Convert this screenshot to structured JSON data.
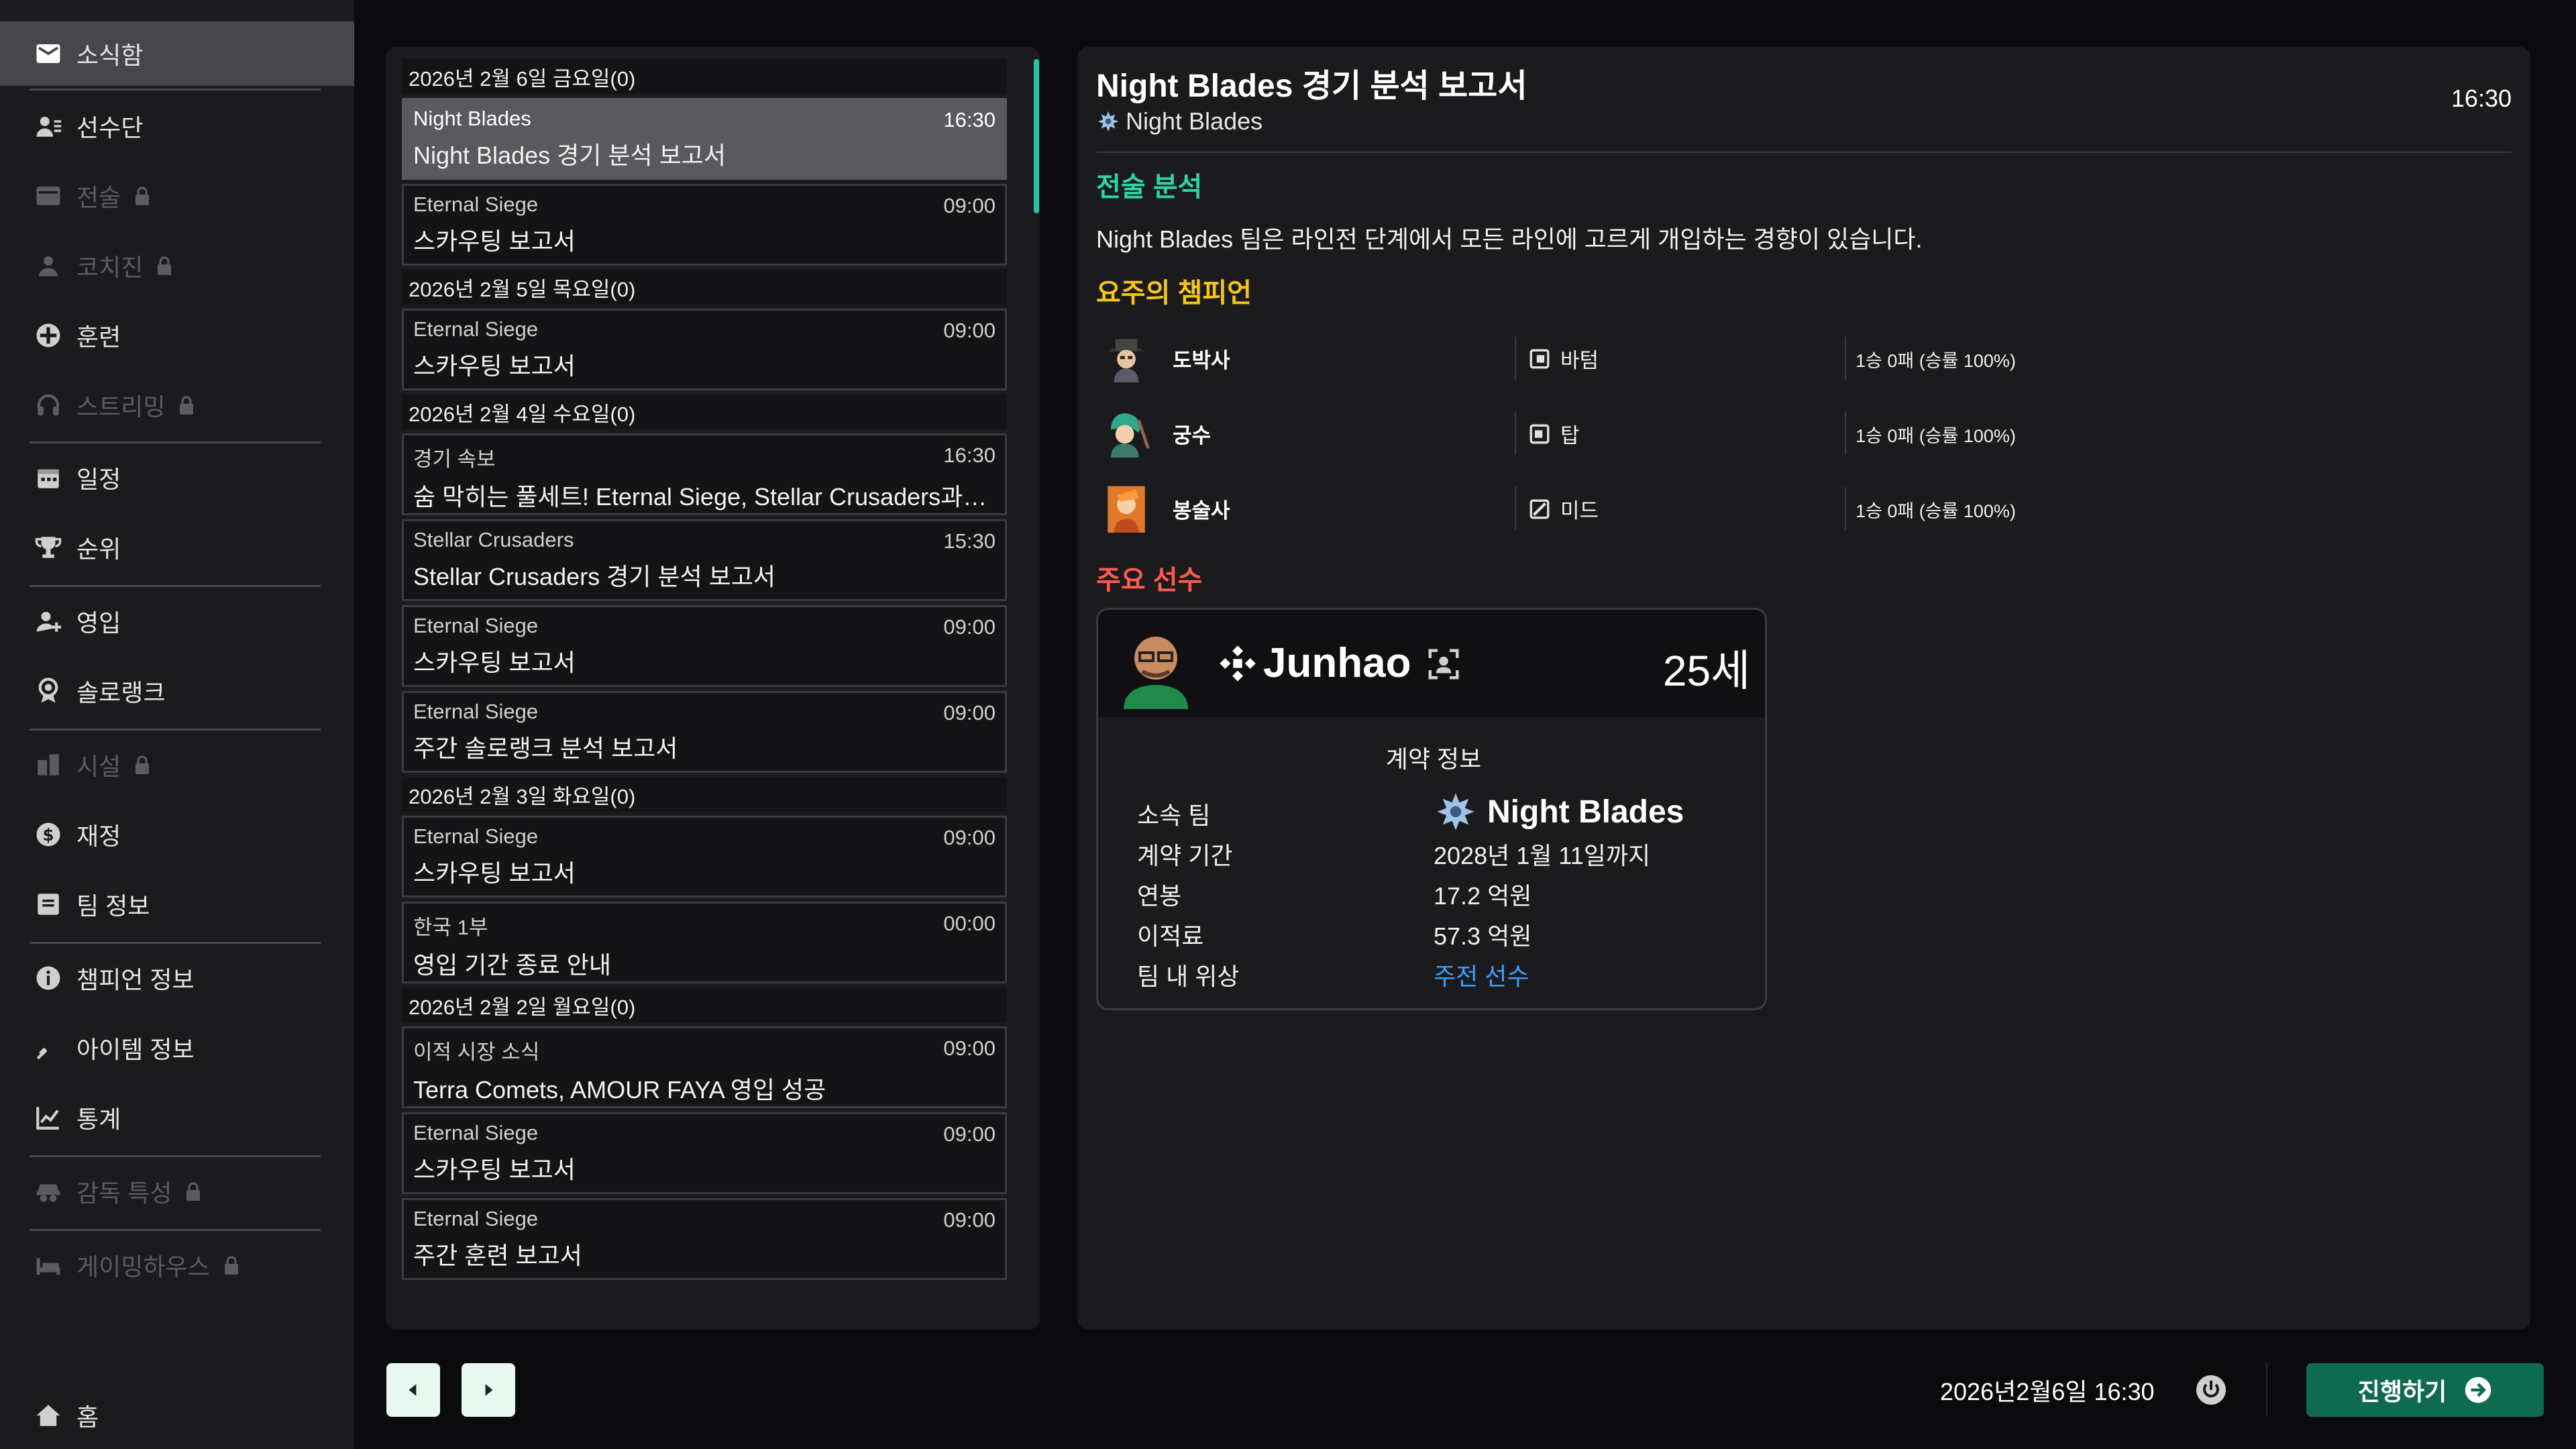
{
  "sidebar": {
    "items": [
      {
        "label": "소식함",
        "icon": "mail-icon",
        "active": true,
        "locked": false
      },
      {
        "label": "선수단",
        "icon": "roster-icon",
        "locked": false
      },
      {
        "label": "전술",
        "icon": "tactics-icon",
        "locked": true
      },
      {
        "label": "코치진",
        "icon": "coach-icon",
        "locked": true
      },
      {
        "label": "훈련",
        "icon": "training-icon",
        "locked": false
      },
      {
        "label": "스트리밍",
        "icon": "headset-icon",
        "locked": true
      },
      {
        "label": "일정",
        "icon": "calendar-icon",
        "locked": false
      },
      {
        "label": "순위",
        "icon": "trophy-icon",
        "locked": false
      },
      {
        "label": "영입",
        "icon": "add-person-icon",
        "locked": false
      },
      {
        "label": "솔로랭크",
        "icon": "medal-icon",
        "locked": false
      },
      {
        "label": "시설",
        "icon": "building-icon",
        "locked": true
      },
      {
        "label": "재정",
        "icon": "money-icon",
        "locked": false
      },
      {
        "label": "팀 정보",
        "icon": "team-info-icon",
        "locked": false
      },
      {
        "label": "챔피언 정보",
        "icon": "info-icon",
        "locked": false
      },
      {
        "label": "아이템 정보",
        "icon": "sword-icon",
        "locked": false
      },
      {
        "label": "통계",
        "icon": "chart-icon",
        "locked": false
      },
      {
        "label": "감독 특성",
        "icon": "manager-icon",
        "locked": true
      },
      {
        "label": "게이밍하우스",
        "icon": "bed-icon",
        "locked": true
      }
    ],
    "home": "홈"
  },
  "mail": {
    "days": [
      {
        "date": "2026년 2월 6일 금요일(0)",
        "items": [
          {
            "sender": "Night Blades",
            "time": "16:30",
            "subject": "Night Blades 경기 분석 보고서",
            "selected": true
          },
          {
            "sender": "Eternal Siege",
            "time": "09:00",
            "subject": "스카우팅 보고서"
          }
        ]
      },
      {
        "date": "2026년 2월 5일 목요일(0)",
        "items": [
          {
            "sender": "Eternal Siege",
            "time": "09:00",
            "subject": "스카우팅 보고서"
          }
        ]
      },
      {
        "date": "2026년 2월 4일 수요일(0)",
        "items": [
          {
            "sender": "경기 속보",
            "time": "16:30",
            "subject": "숨 막히는 풀세트! Eternal Siege, Stellar Crusaders과의 ..."
          },
          {
            "sender": "Stellar Crusaders",
            "time": "15:30",
            "subject": "Stellar Crusaders 경기 분석 보고서"
          },
          {
            "sender": "Eternal Siege",
            "time": "09:00",
            "subject": "스카우팅 보고서"
          },
          {
            "sender": "Eternal Siege",
            "time": "09:00",
            "subject": "주간 솔로랭크 분석 보고서"
          }
        ]
      },
      {
        "date": "2026년 2월 3일 화요일(0)",
        "items": [
          {
            "sender": "Eternal Siege",
            "time": "09:00",
            "subject": "스카우팅 보고서"
          },
          {
            "sender": "한국 1부",
            "time": "00:00",
            "subject": "영입 기간 종료 안내"
          }
        ]
      },
      {
        "date": "2026년 2월 2일 월요일(0)",
        "items": [
          {
            "sender": "이적 시장 소식",
            "time": "09:00",
            "subject": "Terra Comets, AMOUR FAYA 영입 성공"
          },
          {
            "sender": "Eternal Siege",
            "time": "09:00",
            "subject": "스카우팅 보고서"
          },
          {
            "sender": "Eternal Siege",
            "time": "09:00",
            "subject": "주간 훈련 보고서"
          }
        ]
      }
    ]
  },
  "detail": {
    "title": "Night Blades 경기 분석 보고서",
    "team": "Night Blades",
    "time": "16:30",
    "tactics_heading": "전술 분석",
    "tactics_text": "Night Blades 팀은 라인전 단계에서 모든 라인에 고르게 개입하는 경향이 있습니다.",
    "champions_heading": "요주의 챔피언",
    "champions": [
      {
        "name": "도박사",
        "position": "바텀",
        "record": "1승 0패 (승률 100%)"
      },
      {
        "name": "궁수",
        "position": "탑",
        "record": "1승 0패 (승률 100%)"
      },
      {
        "name": "봉술사",
        "position": "미드",
        "record": "1승 0패 (승률 100%)"
      }
    ],
    "players_heading": "주요 선수",
    "player": {
      "name": "Junhao",
      "age": "25세",
      "contract_title": "계약 정보",
      "rows": [
        {
          "key": "소속 팀",
          "value": "Night Blades"
        },
        {
          "key": "계약 기간",
          "value": "2028년 1월 11일까지"
        },
        {
          "key": "연봉",
          "value": "17.2 억원"
        },
        {
          "key": "이적료",
          "value": "57.3 억원"
        },
        {
          "key": "팀 내 위상",
          "value": "주전 선수"
        }
      ]
    }
  },
  "bottom": {
    "datetime": "2026년2월6일 16:30",
    "proceed": "진행하기"
  },
  "colors": {
    "accent": "#22c3a6",
    "proceed": "#0f6b4f",
    "green": "#2dd4a7",
    "yellow": "#f5c518",
    "red": "#ff5a4e",
    "link": "#3aa0ff"
  }
}
